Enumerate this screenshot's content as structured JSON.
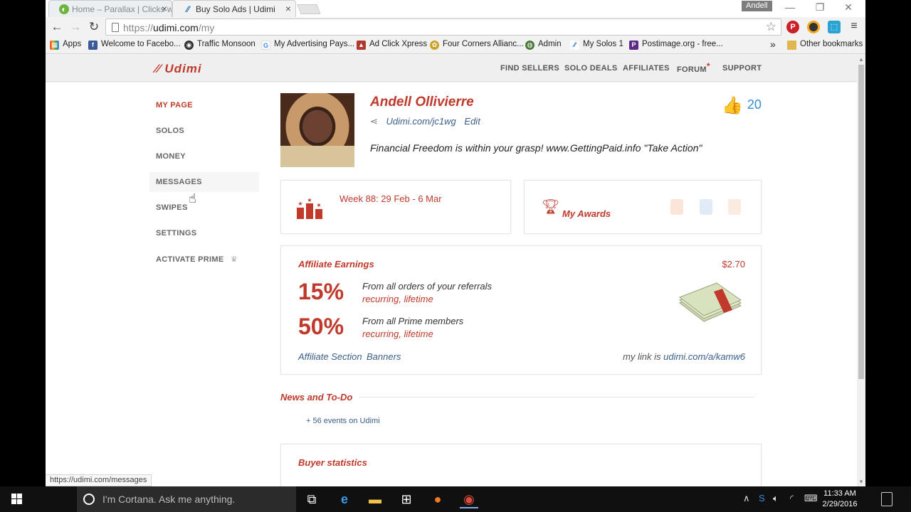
{
  "browser": {
    "tabs": [
      {
        "title": "Home – Parallax | Clicks w",
        "favicon": "parallax-green-icon"
      },
      {
        "title": "Buy Solo Ads | Udimi",
        "favicon": "udimi-icon"
      }
    ],
    "profile_name": "Andell",
    "url_prefix": "https://",
    "url_host": "udimi.com",
    "url_path": "/my",
    "bookmarks": [
      {
        "label": "Apps",
        "icon": "apps-grid-icon",
        "color": "#e84c3d"
      },
      {
        "label": "Welcome to Facebo...",
        "icon": "facebook-icon",
        "color": "#3b5998"
      },
      {
        "label": "Traffic Monsoon",
        "icon": "traffic-monsoon-icon",
        "color": "#333333"
      },
      {
        "label": "My Advertising Pays...",
        "icon": "google-icon",
        "color": "#4285f4"
      },
      {
        "label": "Ad Click Xpress",
        "icon": "adclickxpress-icon",
        "color": "#b03a2e"
      },
      {
        "label": "Four Corners Allianc...",
        "icon": "four-corners-icon",
        "color": "#c9a227"
      },
      {
        "label": "Admin",
        "icon": "globe-icon",
        "color": "#4a7a3a"
      },
      {
        "label": "My Solos 1",
        "icon": "udimi-icon",
        "color": "#1e6fc1"
      },
      {
        "label": "Postimage.org - free...",
        "icon": "postimage-icon",
        "color": "#5b2a86"
      }
    ],
    "other_bookmarks": "Other bookmarks",
    "status_url": "https://udimi.com/messages"
  },
  "site": {
    "logo": "Udimi",
    "nav": [
      "FIND SELLERS",
      "SOLO DEALS",
      "AFFILIATES",
      "FORUM",
      "SUPPORT"
    ],
    "sidebar": [
      "MY PAGE",
      "SOLOS",
      "MONEY",
      "MESSAGES",
      "SWIPES",
      "SETTINGS",
      "ACTIVATE PRIME"
    ]
  },
  "profile": {
    "name": "Andell Ollivierre",
    "link": "Udimi.com/jc1wg",
    "edit": "Edit",
    "tagline": "Financial Freedom is within your grasp! www.GettingPaid.info \"Take Action\"",
    "likes": "20"
  },
  "week": {
    "text": "Week 88: 29 Feb - 6 Mar"
  },
  "awards": {
    "label": "My Awards"
  },
  "affiliate": {
    "title": "Affiliate Earnings",
    "amount": "$2.70",
    "rows": [
      {
        "pct": "15%",
        "desc": "From all orders of your referrals",
        "sub": "recurring, lifetime"
      },
      {
        "pct": "50%",
        "desc": "From all Prime members",
        "sub": "recurring, lifetime"
      }
    ],
    "section_link": "Affiliate Section",
    "banners_link": "Banners",
    "mylink_prefix": "my link is ",
    "mylink": "udimi.com/a/kamw6"
  },
  "news": {
    "title": "News and To-Do",
    "events": "+ 56 events on Udimi"
  },
  "buyer": {
    "title": "Buyer statistics"
  },
  "taskbar": {
    "cortana_placeholder": "I'm Cortana. Ask me anything.",
    "time": "11:33 AM",
    "date": "2/29/2016"
  }
}
